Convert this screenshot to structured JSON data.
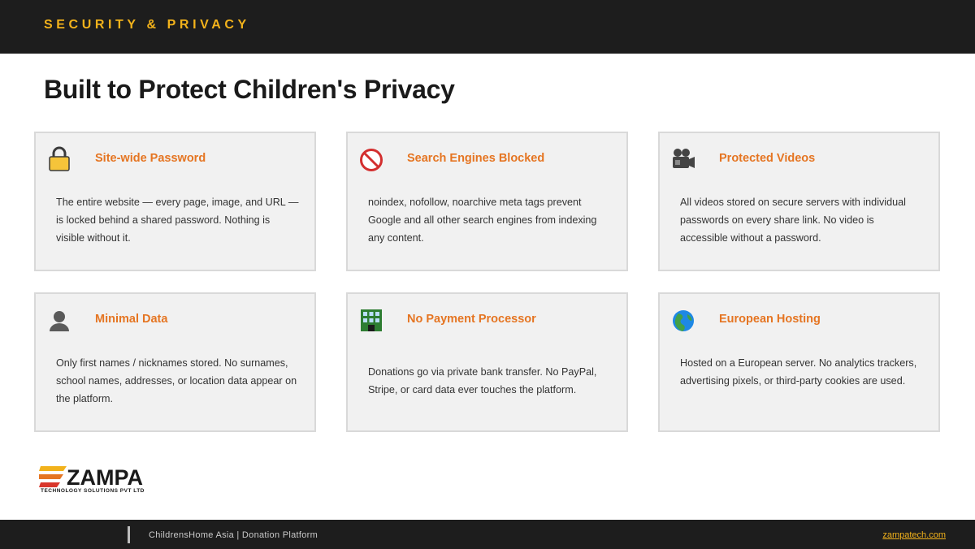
{
  "header": {
    "section_label": "SECURITY & PRIVACY"
  },
  "page": {
    "title": "Built to Protect Children's Privacy"
  },
  "cards": [
    {
      "icon": "lock-icon",
      "title": "Site-wide Password",
      "description": "The entire website — every page, image, and URL — is locked behind a shared password. Nothing is visible without it."
    },
    {
      "icon": "prohibited-icon",
      "title": "Search Engines Blocked",
      "description": "noindex, nofollow, noarchive meta tags prevent Google and all other search engines from indexing any content."
    },
    {
      "icon": "movie-camera-icon",
      "title": "Protected Videos",
      "description": "All videos stored on secure servers with individual passwords on every share link. No video is accessible without a password."
    },
    {
      "icon": "person-silhouette-icon",
      "title": "Minimal Data",
      "description": "Only first names / nicknames stored. No surnames, school names, addresses, or location data appear on the platform."
    },
    {
      "icon": "bank-building-icon",
      "title": "No Payment Processor",
      "description": "Donations go via private bank transfer. No PayPal, Stripe, or card data ever touches the platform."
    },
    {
      "icon": "globe-icon",
      "title": "European Hosting",
      "description": "Hosted on a European server. No analytics trackers, advertising pixels, or third-party cookies are used."
    }
  ],
  "logo": {
    "name": "ZAMPA",
    "tagline": "TECHNOLOGY SOLUTIONS PVT LTD"
  },
  "footer": {
    "text": "ChildrensHome Asia  |  Donation Platform",
    "link": "zampatech.com"
  },
  "colors": {
    "accent": "#f2b21b",
    "card_title": "#e57522",
    "dark_bar": "#1d1d1d",
    "card_bg": "#f1f1f1"
  }
}
